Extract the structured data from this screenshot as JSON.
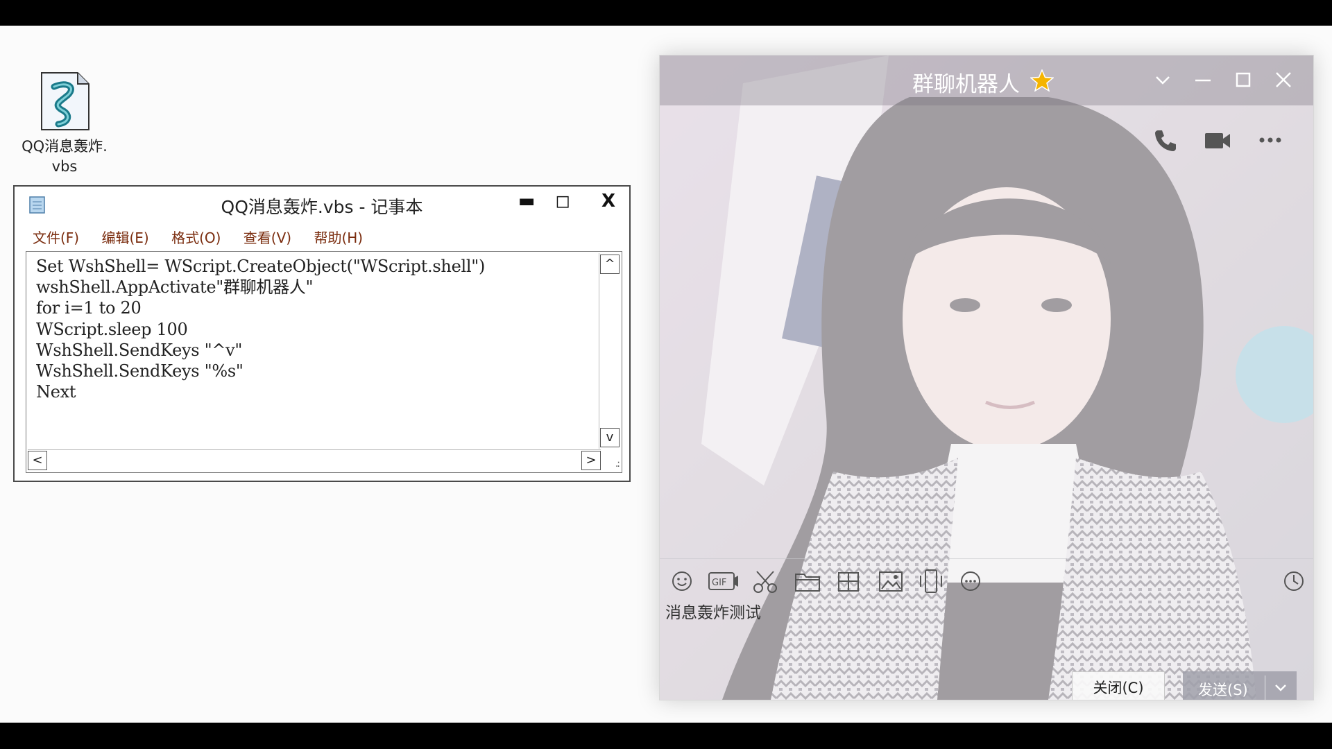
{
  "desktop_icon": {
    "label": "QQ消息轰炸.\nvbs"
  },
  "notepad": {
    "title": "QQ消息轰炸.vbs - 记事本",
    "controls": {
      "minimize": "▬",
      "maximize": "◻",
      "close": "X"
    },
    "menu": [
      "文件(F)",
      "编辑(E)",
      "格式(O)",
      "查看(V)",
      "帮助(H)"
    ],
    "content": "Set WshShell= WScript.CreateObject(\"WScript.shell\")\nwshShell.AppActivate\"群聊机器人\"\nfor i=1 to 20\nWScript.sleep 100\nWshShell.SendKeys \"^v\"\nWshShell.SendKeys \"%s\"\nNext",
    "scroll": {
      "up": "^",
      "down": "v",
      "left": "<",
      "right": ">",
      "grip": ".:"
    }
  },
  "qq": {
    "chat_name": "群聊机器人",
    "input_text": "消息轰炸测试",
    "close_label": "关闭(C)",
    "send_label": "发送(S)",
    "toolbar_icons": [
      "emoji-icon",
      "gif-icon",
      "scissors-icon",
      "folder-icon",
      "screenshot-icon",
      "image-icon",
      "shake-icon",
      "more-icon",
      "history-icon"
    ],
    "top_tools": [
      "phone-icon",
      "video-icon",
      "more-options-icon"
    ]
  },
  "colors": {
    "menu_text": "#7a2c0e",
    "star": "#f5b400"
  }
}
